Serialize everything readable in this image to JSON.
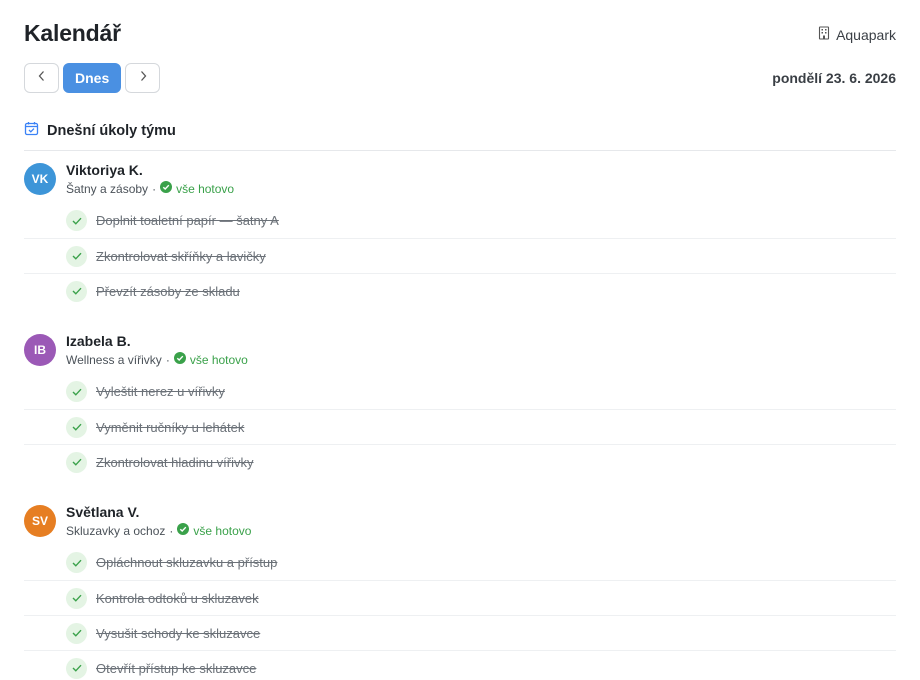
{
  "page": {
    "title": "Kalendář",
    "location": "Aquapark",
    "location_icon": "building-icon"
  },
  "nav": {
    "prev_icon": "chevron-left-icon",
    "today_label": "Dnes",
    "next_icon": "chevron-right-icon",
    "date": "pondělí 23. 6. 2026"
  },
  "section": {
    "title": "Dnešní úkoly týmu",
    "icon": "calendar-check-icon"
  },
  "colors": {
    "accent": "#4a90e2",
    "done_green": "#3aa14a",
    "check_bg": "#e4f4e4"
  },
  "people": [
    {
      "initials": "VK",
      "name": "Viktoriya K.",
      "area": "Šatny a zásoby",
      "separator": "·",
      "status": "vše hotovo",
      "avatar_color": "#3d95d8",
      "tasks": [
        "Doplnit toaletní papír — šatny A",
        "Zkontrolovat skříňky a lavičky",
        "Převzít zásoby ze skladu"
      ]
    },
    {
      "initials": "IB",
      "name": "Izabela B.",
      "area": "Wellness a vířivky",
      "separator": "·",
      "status": "vše hotovo",
      "avatar_color": "#9b59b6",
      "tasks": [
        "Vyleštit nerez u vířivky",
        "Vyměnit ručníky u lehátek",
        "Zkontrolovat hladinu vířivky"
      ]
    },
    {
      "initials": "SV",
      "name": "Světlana V.",
      "area": "Skluzavky a ochoz",
      "separator": "·",
      "status": "vše hotovo",
      "avatar_color": "#e67e22",
      "tasks": [
        "Opláchnout skluzavku a přístup",
        "Kontrola odtoků u skluzavek",
        "Vysušit schody ke skluzavce",
        "Otevřít přístup ke skluzavce"
      ]
    }
  ]
}
